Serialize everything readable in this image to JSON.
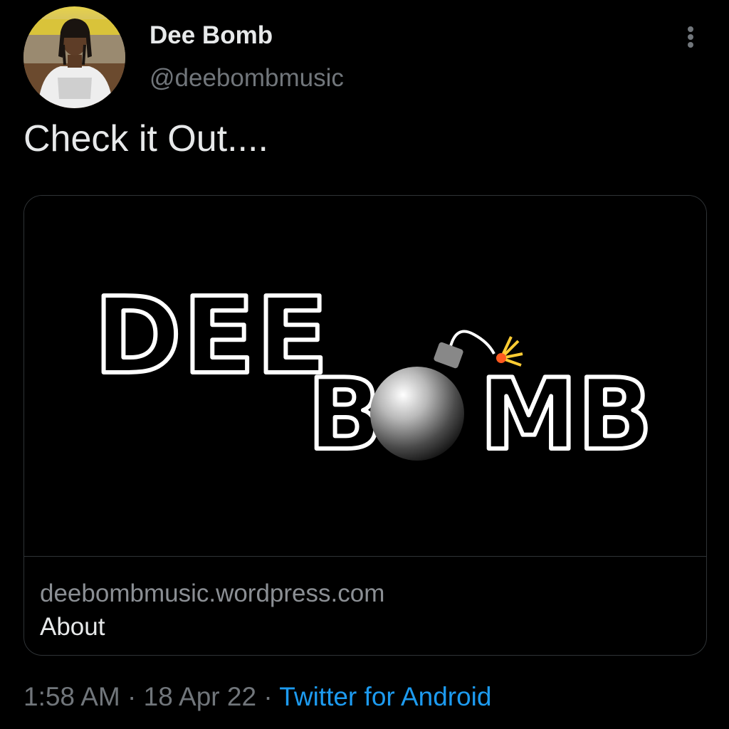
{
  "tweet": {
    "author": {
      "name": "Dee Bomb",
      "handle": "@deebombmusic",
      "avatar_icon": "profile-photo"
    },
    "text": "Check it Out....",
    "card": {
      "image_logo_text": [
        "DEE",
        "B",
        "MB"
      ],
      "domain": "deebombmusic.wordpress.com",
      "title": "About"
    },
    "meta": {
      "time": "1:58 AM",
      "separator": "·",
      "date": "18 Apr 22",
      "source": "Twitter for Android"
    }
  },
  "colors": {
    "background": "#000000",
    "primary_text": "#e7e9ea",
    "secondary_text": "#71767b",
    "link": "#1d9bf0",
    "border": "#2f3336"
  }
}
